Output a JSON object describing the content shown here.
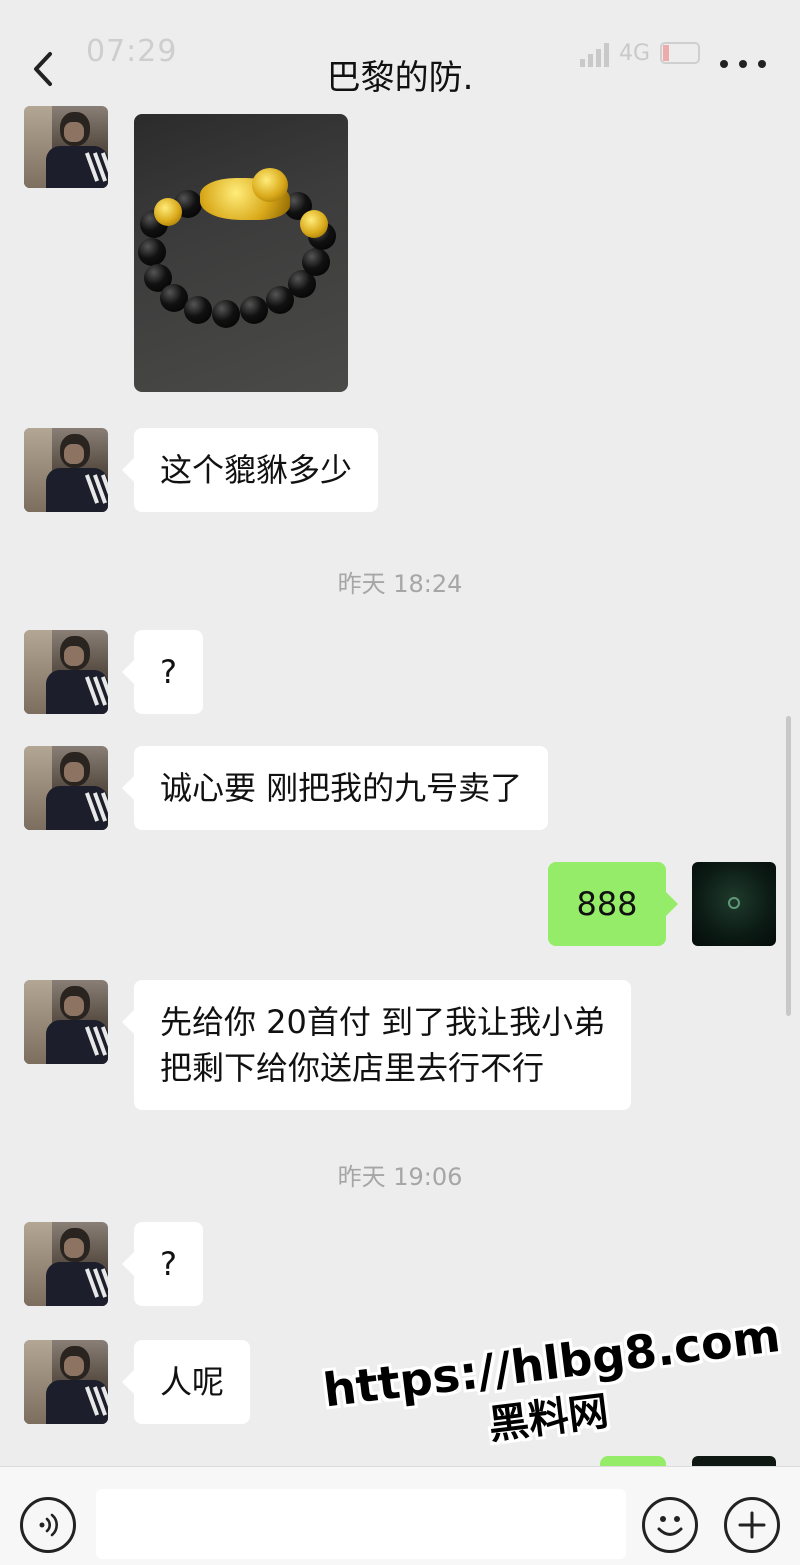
{
  "status_bar": {
    "time": "07:29",
    "network": "4G"
  },
  "header": {
    "title": "巴黎的防."
  },
  "messages": [
    {
      "side": "left",
      "type": "image",
      "image_desc": "gold-pixiu-obsidian-bracelet"
    },
    {
      "side": "left",
      "type": "text",
      "text": "这个貔貅多少"
    },
    {
      "type": "timestamp",
      "text": "昨天 18:24"
    },
    {
      "side": "left",
      "type": "text",
      "text": "?"
    },
    {
      "side": "left",
      "type": "text",
      "text": "诚心要 刚把我的九号卖了"
    },
    {
      "side": "right",
      "type": "text",
      "text": "888"
    },
    {
      "side": "left",
      "type": "text",
      "lines": [
        "先给你 20首付 到了我让我小弟",
        "把剩下给你送店里去行不行"
      ]
    },
    {
      "type": "timestamp",
      "text": "昨天 19:06"
    },
    {
      "side": "left",
      "type": "text",
      "text": "?"
    },
    {
      "side": "left",
      "type": "text",
      "text": "人呢"
    }
  ],
  "watermark": {
    "url": "https://hlbg8.com",
    "name": "黑料网"
  },
  "input_bar": {
    "voice_icon": "voice-icon",
    "emoji_icon": "emoji-icon",
    "plus_icon": "plus-icon"
  }
}
